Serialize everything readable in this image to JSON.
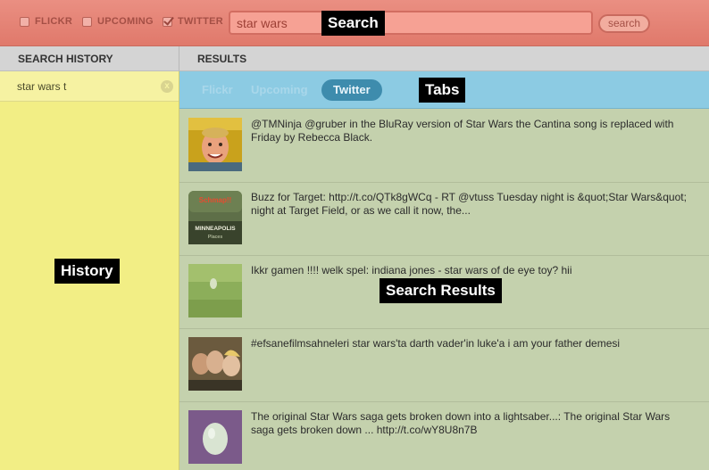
{
  "filters": [
    {
      "label": "FLICKR",
      "checked": false
    },
    {
      "label": "UPCOMING",
      "checked": false
    },
    {
      "label": "TWITTER",
      "checked": true
    }
  ],
  "search": {
    "value": "star wars",
    "button_label": "search"
  },
  "columns": {
    "history": "SEARCH HISTORY",
    "results": "RESULTS"
  },
  "history": {
    "items": [
      {
        "label": "star wars t",
        "clear_icon": "x"
      }
    ]
  },
  "tabs": [
    {
      "label": "Flickr",
      "active": false
    },
    {
      "label": "Upcoming",
      "active": false
    },
    {
      "label": "Twitter",
      "active": true
    }
  ],
  "results": [
    {
      "text": "@TMNinja @gruber in the BluRay version of Star Wars the Cantina song is replaced with Friday by Rebecca Black.",
      "thumb_icon": "avatar-face",
      "thumb_color": "#c9a21c"
    },
    {
      "text": "Buzz for Target: http://t.co/QTk8gWCq - RT @vtuss Tuesday night is &quot;Star Wars&quot; night at Target Field, or as we call it now, the...",
      "thumb_icon": "schmap-minneapolis",
      "thumb_color": "#5e6f48",
      "thumb_text": {
        "brand": "Schmap!!",
        "city": "MINNEAPOLIS",
        "caption": "Places"
      }
    },
    {
      "text": "Ikkr gamen !!!! welk spel: indiana jones - star wars of de eye toy? hii",
      "thumb_icon": "grass-field",
      "thumb_color": "#8cae5a"
    },
    {
      "text": "#efsanefilmsahneleri star wars'ta darth vader'in luke'a i am your father demesi",
      "thumb_icon": "group-photo",
      "thumb_color": "#6b5a3e"
    },
    {
      "text": "The original Star Wars saga gets broken down into a lightsaber...: The original Star Wars saga gets broken down ... http://t.co/wY8U8n7B",
      "thumb_icon": "egg-avatar",
      "thumb_color": "#7b5a8a"
    }
  ],
  "callouts": {
    "search": "Search",
    "tabs": "Tabs",
    "history": "History",
    "results": "Search Results"
  }
}
